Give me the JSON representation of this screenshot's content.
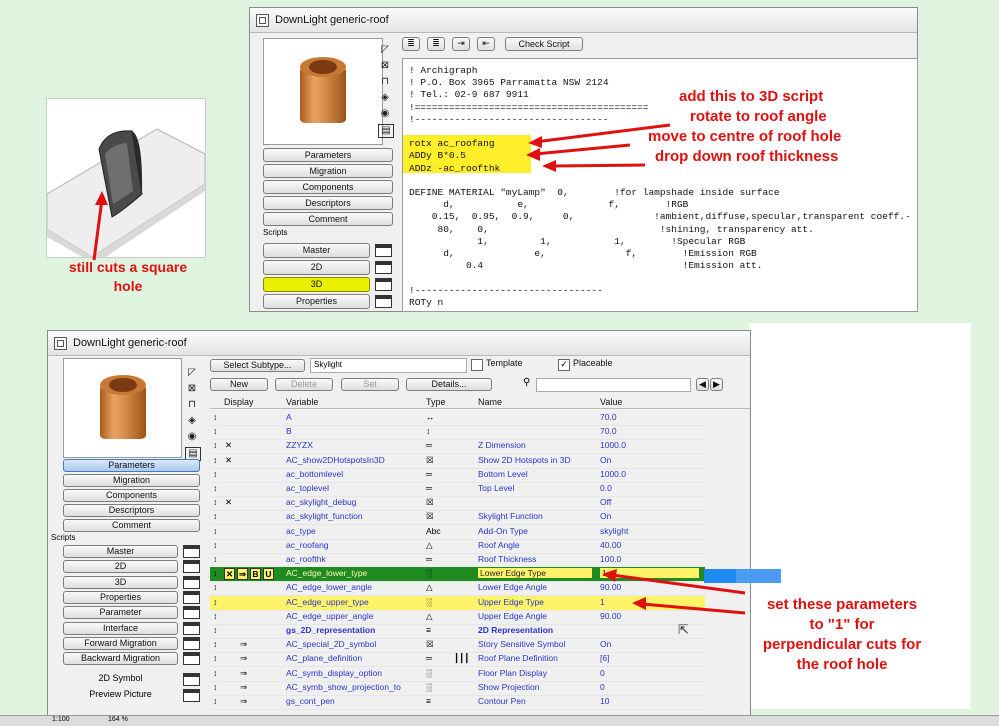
{
  "window_title": "DownLight generic-roof",
  "top_window": {
    "check_script_label": "Check Script",
    "nav_buttons": [
      "Parameters",
      "Migration",
      "Components",
      "Descriptors",
      "Comment"
    ],
    "scripts_label": "Scripts",
    "script_buttons": [
      "Master",
      "2D",
      "3D",
      "Properties"
    ],
    "code_lines": [
      "! Archigraph",
      "! P.O. Box 3965 Parramatta NSW 2124",
      "! Tel.: 02-9 687 9911",
      "!=========================================",
      "!----------------------------------",
      "",
      "rotx ac_roofang",
      "ADDy B*0.5",
      "ADDz -ac_roofthk",
      "",
      "DEFINE MATERIAL \"myLamp\"  0,        !for lampshade inside surface",
      "      d,           e,              f,        !RGB",
      "    0.15,  0.95,  0.9,     0,              !ambient,diffuse,specular,transparent coeff.-",
      "     80,    0,                              !shining, transparency att.",
      "            1,         1,           1,        !Specular RGB",
      "      d,              e,              f,        !Emission RGB",
      "          0.4                                   !Emission att.",
      "",
      "!---------------------------------",
      "ROTy n"
    ],
    "annotations": [
      "add this to 3D script",
      "rotate to roof angle",
      "move to centre of roof hole",
      "drop down roof thickness"
    ]
  },
  "left_callout": "still cuts a square\nhole",
  "bottom_window": {
    "toolbar": {
      "select_subtype": "Select Subtype...",
      "subtype_value": "Skylight",
      "template_label": "Template",
      "placeable_label": "Placeable",
      "new": "New",
      "delete": "Delete",
      "set": "Set",
      "details": "Details..."
    },
    "nav_buttons": [
      "Parameters",
      "Migration",
      "Components",
      "Descriptors",
      "Comment"
    ],
    "scripts_label": "Scripts",
    "script_buttons": [
      "Master",
      "2D",
      "3D",
      "Properties",
      "Parameter",
      "Interface",
      "Forward Migration",
      "Backward Migration",
      "2D Symbol",
      "Preview Picture"
    ],
    "columns": [
      "Display",
      "Variable",
      "Type",
      "Name",
      "Value"
    ],
    "rows": [
      {
        "var": "A",
        "type": "↔",
        "name": "",
        "value": "70.0",
        "mark": ""
      },
      {
        "var": "B",
        "type": "↕",
        "name": "",
        "value": "70.0",
        "mark": ""
      },
      {
        "var": "ZZYZX",
        "type": "═",
        "name": "Z Dimension",
        "value": "1000.0",
        "mark": "x"
      },
      {
        "var": "AC_show2DHotspotsIn3D",
        "type": "☒",
        "name": "Show 2D Hotspots in 3D",
        "value": "On",
        "mark": "x"
      },
      {
        "var": "ac_bottomlevel",
        "type": "═",
        "name": "Bottom Level",
        "value": "1000.0",
        "mark": ""
      },
      {
        "var": "ac_toplevel",
        "type": "═",
        "name": "Top Level",
        "value": "0.0",
        "mark": ""
      },
      {
        "var": "ac_skylight_debug",
        "type": "☒",
        "name": "",
        "value": "Off",
        "mark": "x"
      },
      {
        "var": "ac_skylight_function",
        "type": "☒",
        "name": "Skylight Function",
        "value": "On",
        "mark": ""
      },
      {
        "var": "ac_type",
        "type": "Abc",
        "name": "Add-On Type",
        "value": "skylight",
        "mark": ""
      },
      {
        "var": "ac_roofang",
        "type": "△",
        "name": "Roof Angle",
        "value": "40.00",
        "mark": ""
      },
      {
        "var": "ac_roofthk",
        "type": "═",
        "name": "Roof Thickness",
        "value": "100.0",
        "mark": ""
      },
      {
        "var": "AC_edge_lower_type",
        "type": "░",
        "name": "Lower Edge Type",
        "value": "1",
        "mark": ""
      },
      {
        "var": "AC_edge_lower_angle",
        "type": "△",
        "name": "Lower Edge Angle",
        "value": "90.00",
        "mark": ""
      },
      {
        "var": "AC_edge_upper_type",
        "type": "░",
        "name": "Upper Edge Type",
        "value": "1",
        "mark": ""
      },
      {
        "var": "AC_edge_upper_angle",
        "type": "△",
        "name": "Upper Edge Angle",
        "value": "90.00",
        "mark": ""
      },
      {
        "var": "gs_2D_representation",
        "type": "≡",
        "name": "2D Representation",
        "value": "",
        "mark": ""
      },
      {
        "var": "AC_special_2D_symbol",
        "type": "☒",
        "name": "Story Sensitive Symbol",
        "value": "On",
        "mark": "arrow"
      },
      {
        "var": "AC_plane_definition",
        "type": "═",
        "name": "Roof Plane Definition",
        "value": "[6]",
        "mark": "arrow"
      },
      {
        "var": "AC_symb_display_option",
        "type": "░",
        "name": "Floor Plan Display",
        "value": "0",
        "mark": "arrow"
      },
      {
        "var": "AC_symb_show_projection_to",
        "type": "░",
        "name": "Show Projection",
        "value": "0",
        "mark": "arrow"
      },
      {
        "var": "gs_cont_pen",
        "type": "≡",
        "name": "Contour Pen",
        "value": "10",
        "mark": "arrow"
      }
    ],
    "selected_row_icons": [
      "x",
      "B",
      "U"
    ],
    "callout": "set these parameters\nto \"1\" for\nperpendicular cuts for\nthe roof hole"
  },
  "status_bar": [
    "1:100",
    "164 %"
  ]
}
